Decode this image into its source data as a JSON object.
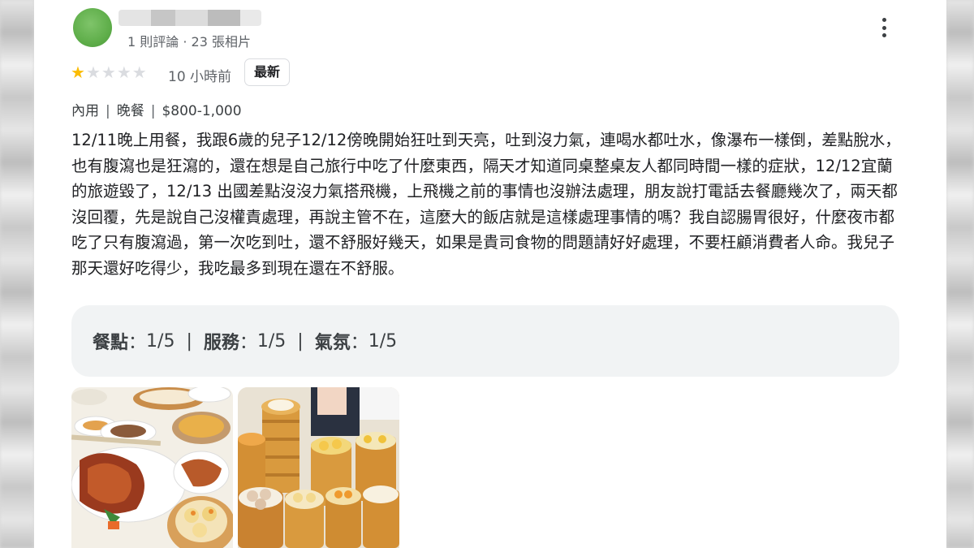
{
  "reviewer": {
    "meta": "1 則評論 · 23 張相片"
  },
  "rating": {
    "stars": 1,
    "max_stars": 5
  },
  "time": "10 小時前",
  "badge": "最新",
  "tags": [
    "內用",
    "晚餐",
    "$800-1,000"
  ],
  "review_text": "12/11晚上用餐，我跟6歲的兒子12/12傍晚開始狂吐到天亮，吐到沒力氣，連喝水都吐水，像瀑布一樣倒，差點脫水，也有腹瀉也是狂瀉的，還在想是自己旅行中吃了什麼東西，隔天才知道同桌整桌友人都同時間一樣的症狀，12/12宜蘭的旅遊毀了，12/13 出國差點沒沒力氣搭飛機，上飛機之前的事情也沒辦法處理，朋友說打電話去餐廳幾次了，兩天都沒回覆，先是說自己沒權責處理，再說主管不在，這麼大的飯店就是這樣處理事情的嗎？我自認腸胃很好，什麼夜市都吃了只有腹瀉過，第一次吃到吐，還不舒服好幾天，如果是貴司食物的問題請好好處理，不要枉顧消費者人命。我兒子那天還好吃得少，我吃最多到現在還在不舒服。",
  "sub_ratings": [
    {
      "label": "餐點",
      "value": "1/5"
    },
    {
      "label": "服務",
      "value": "1/5"
    },
    {
      "label": "氣氛",
      "value": "1/5"
    }
  ],
  "colors": {
    "star_on": "#fbbc04",
    "star_off": "#dadce0",
    "avatar": "#5fae4a"
  },
  "icons": {
    "more": "vertical-ellipsis-icon",
    "star": "star-icon"
  }
}
